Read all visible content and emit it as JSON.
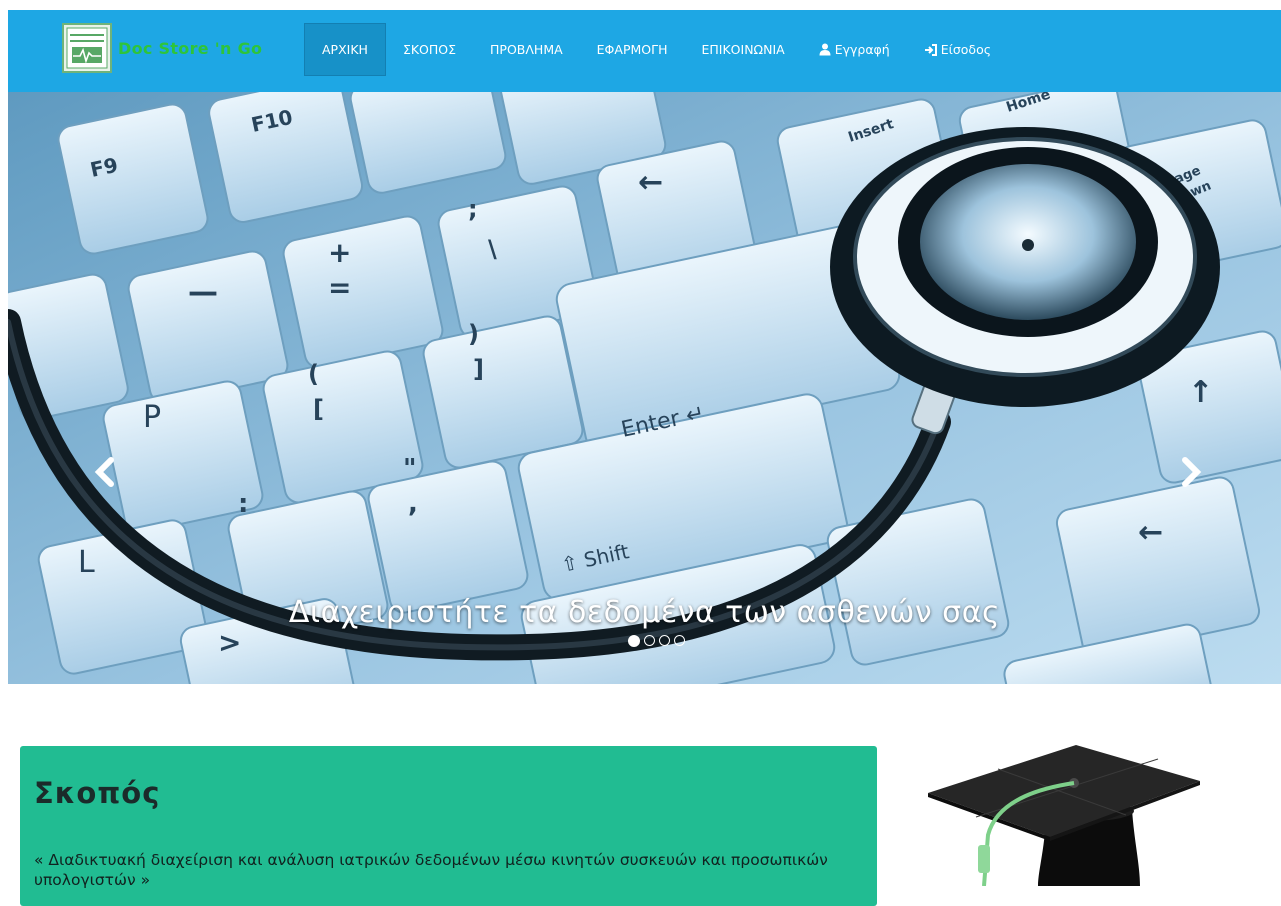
{
  "brand": {
    "name": "Doc Store 'n Go",
    "icon": "ecg-monitor-icon"
  },
  "nav": {
    "items": [
      {
        "label": "ΑΡΧΙΚΗ",
        "active": true
      },
      {
        "label": "ΣΚΟΠΟΣ"
      },
      {
        "label": "ΠΡΟΒΛΗΜΑ"
      },
      {
        "label": "ΕΦΑΡΜΟΓΗ"
      },
      {
        "label": "ΕΠΙΚΟΙΝΩΝΙΑ"
      }
    ],
    "register": {
      "label": "Εγγραφή",
      "icon": "user-icon"
    },
    "login": {
      "label": "Είσοδος",
      "icon": "login-icon"
    }
  },
  "carousel": {
    "caption": "Διαχειριστήτε τα δεδομένα των ασθενών σας",
    "slide_count": 4,
    "active_slide": 1,
    "keys": [
      "F9",
      "F10",
      "+",
      "=",
      "P",
      "[",
      "(",
      "]",
      ")",
      ":",
      "\"",
      ",",
      "L",
      ">",
      "Enter",
      "Shift",
      "Insert",
      "Home",
      "Page Down",
      "←",
      "—"
    ]
  },
  "purpose": {
    "title": "Σκοπός",
    "text": "« Διαδικτυακή διαχείριση και ανάλυση ιατρικών δεδομένων μέσω κινητών συσκευών και προσωπικών υπολογιστών »"
  },
  "colors": {
    "navbar": "#1ea7e4",
    "nav_active": "#1791c8",
    "brand_text": "#2ec43a",
    "purpose_bg": "#21bc92"
  }
}
